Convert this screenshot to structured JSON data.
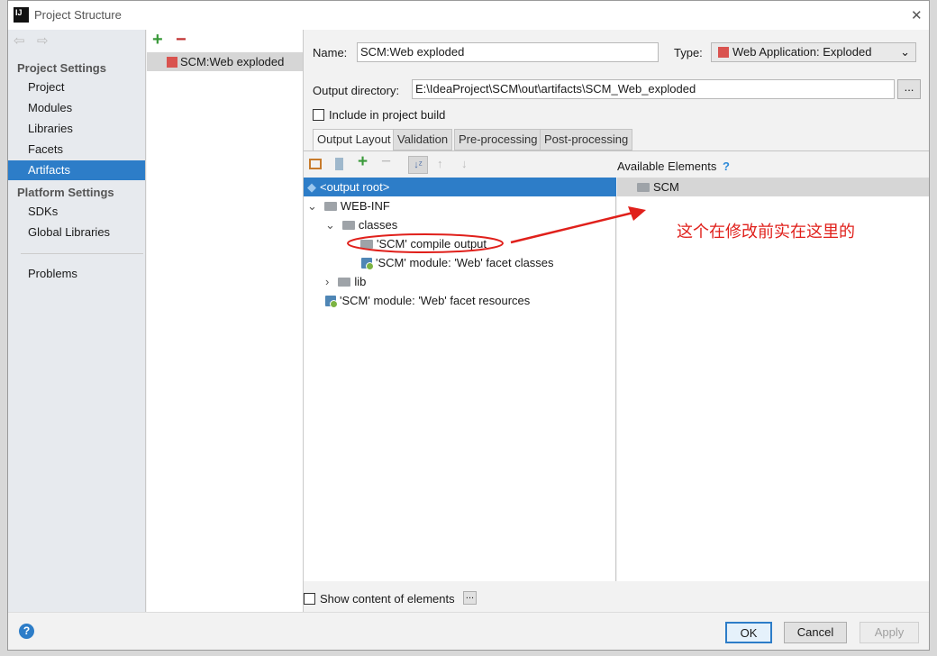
{
  "window": {
    "title": "Project Structure",
    "close": "✕"
  },
  "sidebar": {
    "project_settings": "Project Settings",
    "items": [
      "Project",
      "Modules",
      "Libraries",
      "Facets",
      "Artifacts"
    ],
    "platform_settings": "Platform Settings",
    "platform_items": [
      "SDKs",
      "Global Libraries"
    ],
    "problems": "Problems",
    "selected": "Artifacts"
  },
  "artifacts": {
    "items": [
      "SCM:Web exploded"
    ]
  },
  "form": {
    "name_label": "Name:",
    "name_value": "SCM:Web exploded",
    "type_label": "Type:",
    "type_value": "Web Application: Exploded",
    "output_label": "Output directory:",
    "output_value": "E:\\IdeaProject\\SCM\\out\\artifacts\\SCM_Web_exploded",
    "browse": "...",
    "include_label": "Include in project build",
    "include_checked": false
  },
  "tabs": [
    "Output Layout",
    "Validation",
    "Pre-processing",
    "Post-processing"
  ],
  "tree": [
    {
      "label": "<output root>",
      "selected": true
    },
    {
      "label": "WEB-INF"
    },
    {
      "label": "classes"
    },
    {
      "label": "'SCM' compile output"
    },
    {
      "label": "'SCM' module: 'Web' facet classes"
    },
    {
      "label": "lib"
    },
    {
      "label": "'SCM' module: 'Web' facet resources"
    }
  ],
  "available": {
    "title": "Available Elements",
    "help": "?",
    "items": [
      "SCM"
    ]
  },
  "annotation": {
    "text": "这个在修改前实在这里的",
    "color": "#e0201b"
  },
  "bottom": {
    "show_content": "Show content of elements",
    "more": "...",
    "ok": "OK",
    "cancel": "Cancel",
    "apply": "Apply",
    "help": "?"
  },
  "colors": {
    "selection": "#2d7dc8",
    "accent": "#e0201b"
  }
}
